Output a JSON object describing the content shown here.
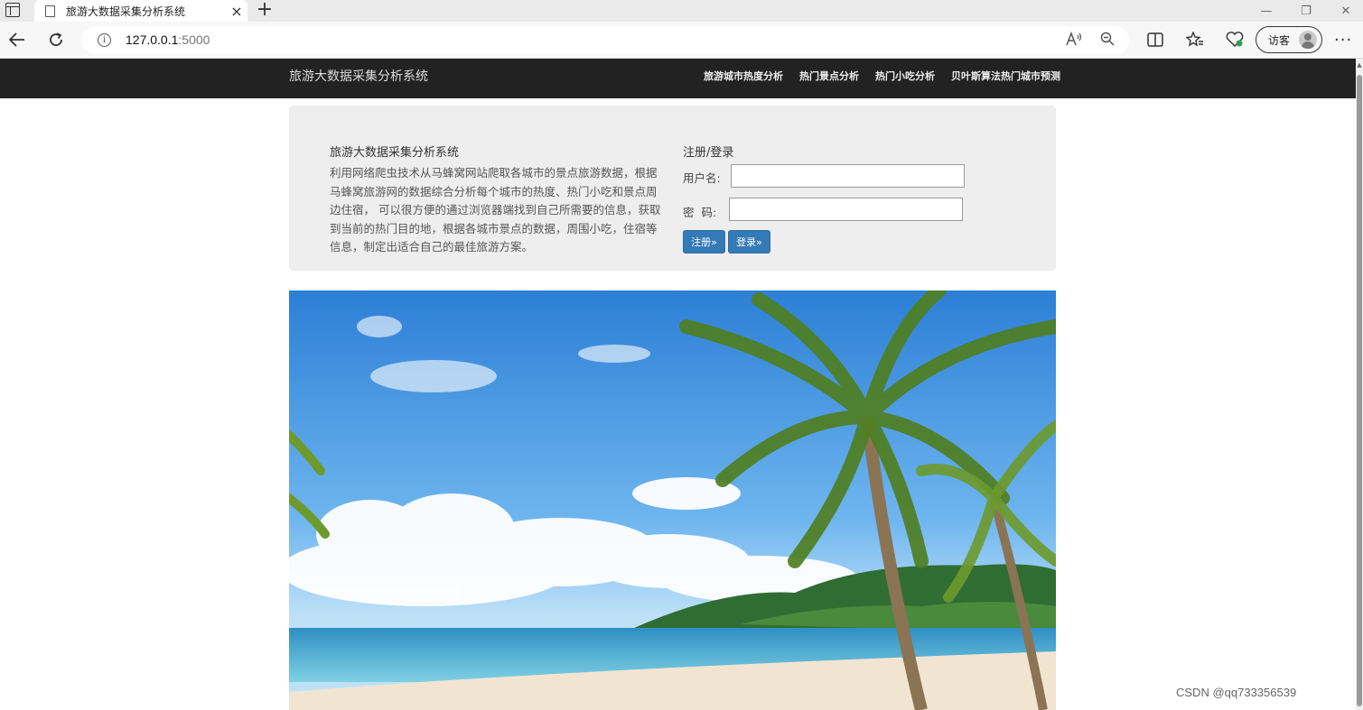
{
  "browser": {
    "tab_title": "旅游大数据采集分析系统",
    "tab_close": "×",
    "new_tab": "+",
    "url_host": "127.0.0.1",
    "url_port": ":5000",
    "guest_label": "访客",
    "window_controls": {
      "minimize": "—",
      "restore": "❐",
      "close": "✕"
    }
  },
  "navbar": {
    "brand": "旅游大数据采集分析系统",
    "links": [
      "旅游城市热度分析",
      "热门景点分析",
      "热门小吃分析",
      "贝叶斯算法热门城市预测"
    ]
  },
  "intro": {
    "title": "旅游大数据采集分析系统",
    "text": "利用网络爬虫技术从马蜂窝网站爬取各城市的景点旅游数据，根据马蜂窝旅游网的数据综合分析每个城市的热度、热门小吃和景点周边住宿， 可以很方便的通过浏览器端找到自己所需要的信息，获取到当前的热门目的地，根据各城市景点的数据，周围小吃，住宿等信息，制定出适合自己的最佳旅游方案。"
  },
  "login": {
    "title": "注册/登录",
    "username_label": "用户名:",
    "password_label": "密  码:",
    "username_value": "",
    "password_value": "",
    "register_button": "注册»",
    "login_button": "登录»"
  },
  "watermark": "CSDN @qq733356539"
}
